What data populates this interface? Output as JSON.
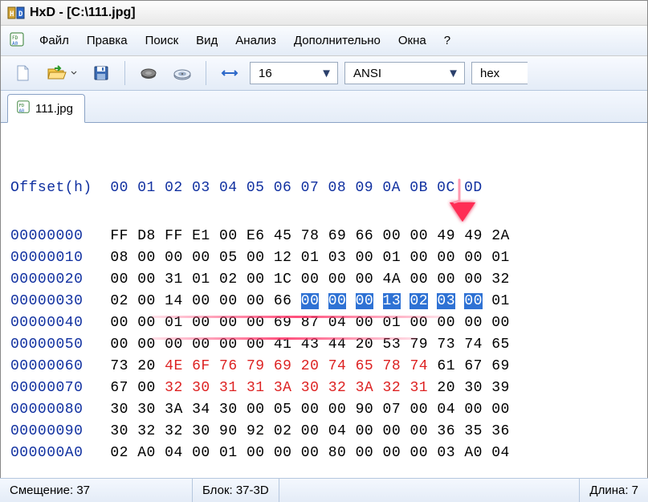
{
  "title": "HxD - [C:\\111.jpg]",
  "menu": {
    "file": "Файл",
    "edit": "Правка",
    "search": "Поиск",
    "view": "Вид",
    "analysis": "Анализ",
    "extra": "Дополнительно",
    "windows": "Окна",
    "help": "?"
  },
  "toolbar": {
    "bytes_per_row": "16",
    "encoding": "ANSI",
    "base": "hex"
  },
  "tab": {
    "name": "111.jpg"
  },
  "hex": {
    "header": "Offset(h)  00 01 02 03 04 05 06 07 08 09 0A 0B 0C 0D",
    "rows": [
      {
        "offset": "00000000",
        "b": [
          "FF",
          "D8",
          "FF",
          "E1",
          "00",
          "E6",
          "45",
          "78",
          "69",
          "66",
          "00",
          "00",
          "49",
          "49",
          "2A"
        ]
      },
      {
        "offset": "00000010",
        "b": [
          "08",
          "00",
          "00",
          "00",
          "05",
          "00",
          "12",
          "01",
          "03",
          "00",
          "01",
          "00",
          "00",
          "00",
          "01"
        ]
      },
      {
        "offset": "00000020",
        "b": [
          "00",
          "00",
          "31",
          "01",
          "02",
          "00",
          "1C",
          "00",
          "00",
          "00",
          "4A",
          "00",
          "00",
          "00",
          "32"
        ]
      },
      {
        "offset": "00000030",
        "b": [
          "02",
          "00",
          "14",
          "00",
          "00",
          "00",
          "66",
          "00",
          "00",
          "00",
          "13",
          "02",
          "03",
          "00",
          "01"
        ]
      },
      {
        "offset": "00000040",
        "b": [
          "00",
          "00",
          "01",
          "00",
          "00",
          "00",
          "69",
          "87",
          "04",
          "00",
          "01",
          "00",
          "00",
          "00",
          "00"
        ]
      },
      {
        "offset": "00000050",
        "b": [
          "00",
          "00",
          "00",
          "00",
          "00",
          "00",
          "41",
          "43",
          "44",
          "20",
          "53",
          "79",
          "73",
          "74",
          "65"
        ]
      },
      {
        "offset": "00000060",
        "b": [
          "73",
          "20",
          "4E",
          "6F",
          "76",
          "79",
          "69",
          "20",
          "74",
          "65",
          "78",
          "74",
          "61",
          "67",
          "69"
        ]
      },
      {
        "offset": "00000070",
        "b": [
          "67",
          "00",
          "32",
          "30",
          "31",
          "31",
          "3A",
          "30",
          "32",
          "3A",
          "32",
          "31",
          "20",
          "30",
          "39"
        ]
      },
      {
        "offset": "00000080",
        "b": [
          "30",
          "30",
          "3A",
          "34",
          "30",
          "00",
          "05",
          "00",
          "00",
          "90",
          "07",
          "00",
          "04",
          "00",
          "00"
        ]
      },
      {
        "offset": "00000090",
        "b": [
          "30",
          "32",
          "32",
          "30",
          "90",
          "92",
          "02",
          "00",
          "04",
          "00",
          "00",
          "00",
          "36",
          "35",
          "36"
        ]
      },
      {
        "offset": "000000A0",
        "b": [
          "02",
          "A0",
          "04",
          "00",
          "01",
          "00",
          "00",
          "00",
          "80",
          "00",
          "00",
          "00",
          "03",
          "A0",
          "04"
        ]
      }
    ],
    "selection": {
      "row": 3,
      "start": 7,
      "end": 13
    },
    "redspan": {
      "row": 6,
      "start": 2,
      "end": 11
    }
  },
  "status": {
    "offset_label": "Смещение: 37",
    "block_label": "Блок: 37-3D",
    "length_label": "Длина: 7"
  }
}
